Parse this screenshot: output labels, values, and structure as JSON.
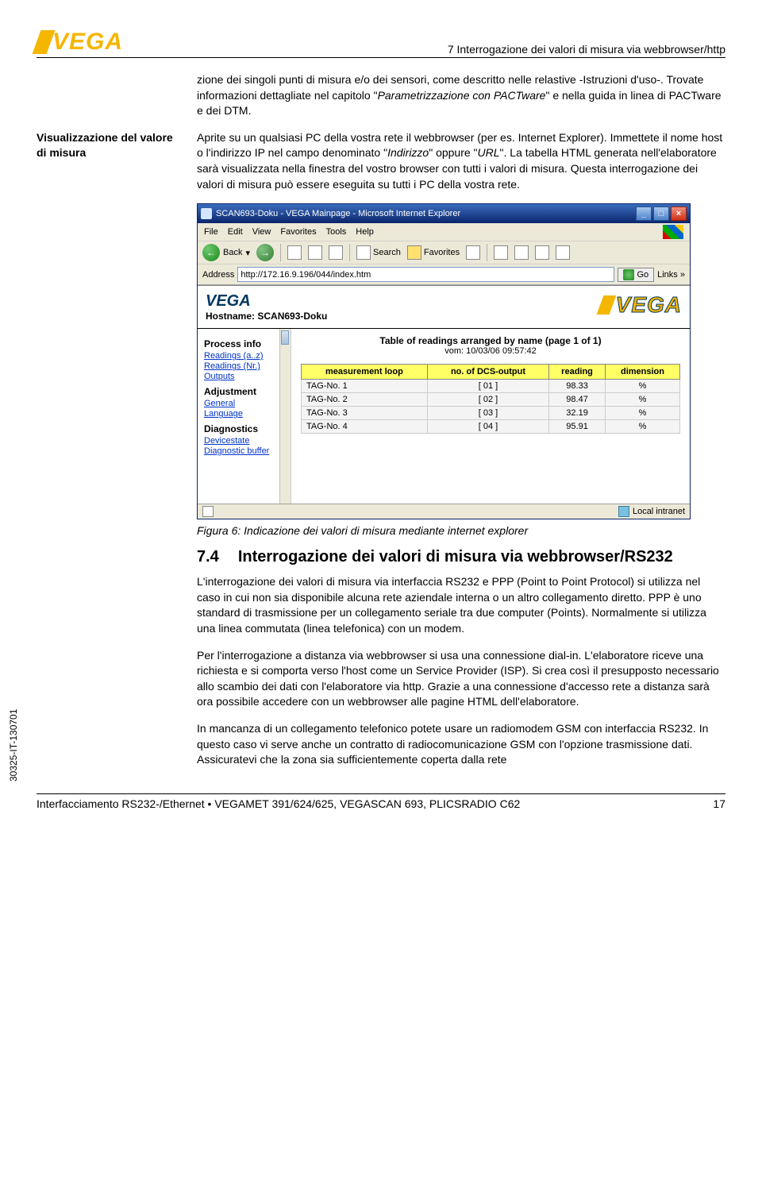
{
  "header": {
    "logo_text": "VEGA",
    "chapter_title": "7 Interrogazione dei valori di misura via webbrowser/http"
  },
  "intro_para": "zione dei singoli punti di misura e/o dei sensori, come descritto nelle relastive -Istruzioni d'uso-. Trovate informazioni dettagliate nel capitolo \"",
  "intro_italic": "Parametrizzazione con PACTware",
  "intro_tail": "\" e nella guida in linea di PACTware e dei DTM.",
  "margin_label": "Visualizzazione del valore di misura",
  "main_para_1a": "Aprite su un qualsiasi PC della vostra rete il webbrowser (per es. Internet Explorer). Immettete il nome host o l'indirizzo IP nel campo denominato \"",
  "main_para_1b": "Indirizzo",
  "main_para_1c": "\" oppure \"",
  "main_para_1d": "URL",
  "main_para_1e": "\". La tabella HTML generata nell'elaboratore sarà visualizzata nella finestra del vostro browser con tutti i valori di misura. Questa interrogazione dei valori di misura può essere eseguita su tutti i PC della vostra rete.",
  "ie": {
    "title": "SCAN693-Doku - VEGA Mainpage - Microsoft Internet Explorer",
    "menu": {
      "file": "File",
      "edit": "Edit",
      "view": "View",
      "favorites": "Favorites",
      "tools": "Tools",
      "help": "Help"
    },
    "toolbar": {
      "back": "Back",
      "search": "Search",
      "favorites": "Favorites"
    },
    "address_label": "Address",
    "address_value": "http://172.16.9.196/044/index.htm",
    "go": "Go",
    "links": "Links",
    "content_header": {
      "logo": "VEGA",
      "hostname_label": "Hostname:",
      "hostname_value": "SCAN693-Doku"
    },
    "sidebar": {
      "group1": "Process info",
      "links1": [
        "Readings (a..z)",
        "Readings (Nr.)",
        "Outputs"
      ],
      "group2": "Adjustment",
      "links2": [
        "General",
        "Language"
      ],
      "group3": "Diagnostics",
      "links3": [
        "Devicestate",
        "Diagnostic buffer"
      ]
    },
    "main": {
      "title": "Table of readings arranged by name  (page 1 of 1)",
      "date": "vom: 10/03/06 09:57:42",
      "headers": [
        "measurement loop",
        "no. of DCS-output",
        "reading",
        "dimension"
      ],
      "rows": [
        [
          "TAG-No. 1",
          "[ 01 ]",
          "98.33",
          "%"
        ],
        [
          "TAG-No. 2",
          "[ 02 ]",
          "98.47",
          "%"
        ],
        [
          "TAG-No. 3",
          "[ 03 ]",
          "32.19",
          "%"
        ],
        [
          "TAG-No. 4",
          "[ 04 ]",
          "95.91",
          "%"
        ]
      ]
    },
    "status": {
      "zone": "Local intranet"
    }
  },
  "figure_caption": "Figura 6: Indicazione dei valori di misura mediante internet explorer",
  "section": {
    "num": "7.4",
    "title": "Interrogazione dei valori di misura via webbrowser/RS232"
  },
  "p74_1": "L'interrogazione dei valori di misura via interfaccia RS232 e PPP (Point to Point Protocol) si utilizza nel caso in cui non sia disponibile alcuna rete aziendale interna o un altro collegamento diretto. PPP è uno standard di trasmissione per un collegamento seriale tra due computer (Points). Normalmente si utilizza una  linea commutata (linea telefonica) con un modem.",
  "p74_2": "Per l'interrogazione a distanza via webbrowser si usa una connessione dial-in. L'elaboratore riceve una richiesta e si comporta verso l'host come un Service Provider (ISP). Si crea così il presupposto necessario allo scambio dei dati con l'elaboratore via http. Grazie a una connessione d'accesso rete a distanza sarà ora possibile accedere con un webbrowser alle pagine HTML dell'elaboratore.",
  "p74_3": "In mancanza di un collegamento telefonico potete usare un radiomodem GSM con interfaccia RS232. In questo caso vi serve anche un contratto di radiocomunicazione GSM con l'opzione trasmissione dati. Assicuratevi che la zona sia sufficientemente coperta dalla rete",
  "side_id": "30325-IT-130701",
  "footer": {
    "left": "Interfacciamento RS232-/Ethernet • VEGAMET 391/624/625, VEGASCAN 693, PLICSRADIO C62",
    "right": "17"
  }
}
